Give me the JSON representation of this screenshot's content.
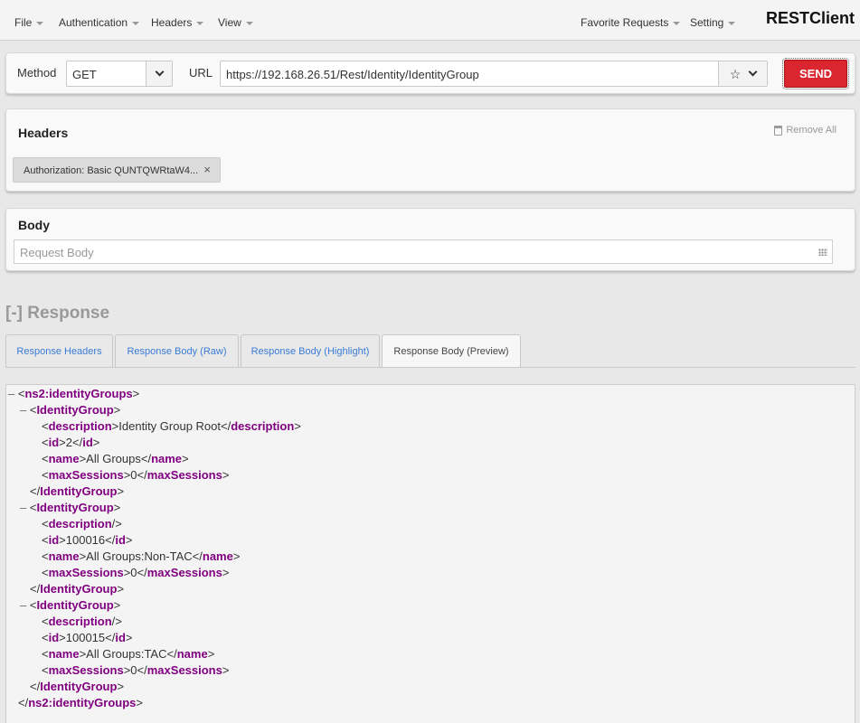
{
  "nav": {
    "menus": [
      "File",
      "Authentication",
      "Headers",
      "View"
    ],
    "right_menus": [
      "Favorite Requests",
      "Setting"
    ],
    "brand": "RESTClient"
  },
  "request": {
    "method_label": "Method",
    "method_value": "GET",
    "url_label": "URL",
    "url_value": "https://192.168.26.51/Rest/Identity/IdentityGroup",
    "star_icon": "☆",
    "send_label": "SEND",
    "send_color": "#d9262f"
  },
  "headers_panel": {
    "title": "Headers",
    "remove_all": "Remove All",
    "tag_text": "Authorization: Basic QUNTQWRtaW4...",
    "tag_close": "×"
  },
  "body_panel": {
    "title": "Body",
    "placeholder": "Request Body"
  },
  "response": {
    "title": "[-] Response",
    "tabs": [
      "Response Headers",
      "Response Body (Raw)",
      "Response Body (Highlight)",
      "Response Body (Preview)"
    ],
    "active_tab": "Response Body (Preview)",
    "xml_lines": [
      {
        "toggle": "–",
        "open": "ns2:identityGroups",
        "text": "",
        "close": "",
        "self": false,
        "end": false
      },
      {
        "toggle": "–",
        "open": "IdentityGroup",
        "text": "",
        "close": "",
        "self": false,
        "end": false
      },
      {
        "toggle": "",
        "open": "description",
        "text": "Identity Group Root",
        "close": "description",
        "self": false,
        "end": false
      },
      {
        "toggle": "",
        "open": "id",
        "text": "2",
        "close": "id",
        "self": false,
        "end": false
      },
      {
        "toggle": "",
        "open": "name",
        "text": "All Groups",
        "close": "name",
        "self": false,
        "end": false
      },
      {
        "toggle": "",
        "open": "maxSessions",
        "text": "0",
        "close": "maxSessions",
        "self": false,
        "end": false
      },
      {
        "toggle": "",
        "open": "",
        "text": "",
        "close": "IdentityGroup",
        "self": false,
        "end": true
      },
      {
        "toggle": "–",
        "open": "IdentityGroup",
        "text": "",
        "close": "",
        "self": false,
        "end": false
      },
      {
        "toggle": "",
        "open": "description",
        "text": "",
        "close": "",
        "self": true,
        "end": false
      },
      {
        "toggle": "",
        "open": "id",
        "text": "100016",
        "close": "id",
        "self": false,
        "end": false
      },
      {
        "toggle": "",
        "open": "name",
        "text": "All Groups:Non-TAC",
        "close": "name",
        "self": false,
        "end": false
      },
      {
        "toggle": "",
        "open": "maxSessions",
        "text": "0",
        "close": "maxSessions",
        "self": false,
        "end": false
      },
      {
        "toggle": "",
        "open": "",
        "text": "",
        "close": "IdentityGroup",
        "self": false,
        "end": true
      },
      {
        "toggle": "–",
        "open": "IdentityGroup",
        "text": "",
        "close": "",
        "self": false,
        "end": false
      },
      {
        "toggle": "",
        "open": "description",
        "text": "",
        "close": "",
        "self": true,
        "end": false
      },
      {
        "toggle": "",
        "open": "id",
        "text": "100015",
        "close": "id",
        "self": false,
        "end": false
      },
      {
        "toggle": "",
        "open": "name",
        "text": "All Groups:TAC",
        "close": "name",
        "self": false,
        "end": false
      },
      {
        "toggle": "",
        "open": "maxSessions",
        "text": "0",
        "close": "maxSessions",
        "self": false,
        "end": false
      },
      {
        "toggle": "",
        "open": "",
        "text": "",
        "close": "IdentityGroup",
        "self": false,
        "end": true
      },
      {
        "toggle": "",
        "open": "",
        "text": "",
        "close": "ns2:identityGroups",
        "self": false,
        "end": true
      }
    ]
  }
}
